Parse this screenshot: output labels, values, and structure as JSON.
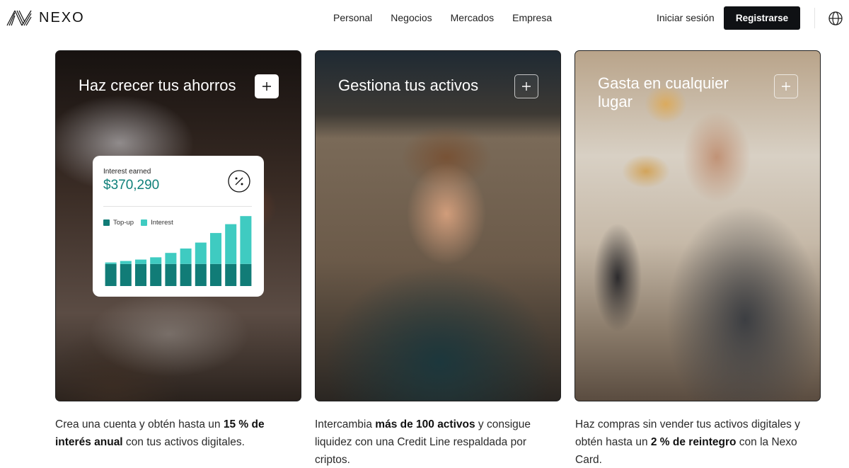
{
  "brand": {
    "name": "NEXO",
    "icon": "nexo-logo-icon"
  },
  "nav": {
    "items": [
      "Personal",
      "Negocios",
      "Mercados",
      "Empresa"
    ],
    "login_label": "Iniciar sesión",
    "register_label": "Registrarse",
    "language_icon": "globe-icon"
  },
  "cards": [
    {
      "title": "Haz crecer tus ahorros",
      "button_icon": "plus-icon",
      "desc_pre": "Crea una cuenta y obtén hasta un ",
      "desc_bold": "15 % de interés anual",
      "desc_post": " con tus activos digitales."
    },
    {
      "title": "Gestiona tus activos",
      "button_icon": "plus-icon",
      "desc_pre": "Intercambia ",
      "desc_bold": "más de 100 activos",
      "desc_post": " y consigue liquidez con una Credit Line respaldada por criptos."
    },
    {
      "title": "Gasta en cualquier lugar",
      "button_icon": "plus-icon",
      "desc_pre": "Haz compras sin vender tus activos digitales y obtén hasta un ",
      "desc_bold": "2 % de reintegro",
      "desc_post": " con la Nexo Card."
    }
  ],
  "widget": {
    "label": "Interest earned",
    "value": "$370,290",
    "icon": "percent-icon",
    "legend": [
      "Top-up",
      "Interest"
    ],
    "colors": {
      "topup": "#117c77",
      "interest": "#3fcbc1",
      "value": "#10807a"
    }
  },
  "chart_data": {
    "type": "bar",
    "stacked": true,
    "categories": [
      "1",
      "2",
      "3",
      "4",
      "5",
      "6",
      "7",
      "8",
      "9",
      "10"
    ],
    "series": [
      {
        "name": "Top-up",
        "values": [
          30,
          30,
          30,
          30,
          30,
          30,
          30,
          30,
          30,
          30
        ]
      },
      {
        "name": "Interest",
        "values": [
          2,
          4,
          6,
          9,
          15,
          21,
          29,
          42,
          54,
          65
        ]
      }
    ],
    "ylim": [
      0,
      100
    ],
    "legend": "top-left",
    "grid": false
  }
}
